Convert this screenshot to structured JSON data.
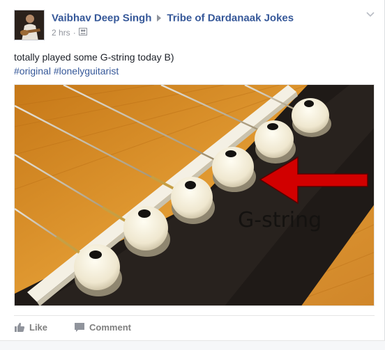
{
  "post": {
    "author": "Vaibhav Deep Singh",
    "group": "Tribe of Dardanaak Jokes",
    "time": "2 hrs",
    "separator": "·",
    "text": "totally played some G-string today B)",
    "hashtags": [
      "#original",
      "#lonelyguitarist"
    ]
  },
  "image": {
    "annotation": "G-string",
    "arrow_color": "#d10000"
  },
  "actions": {
    "like_label": "Like",
    "comment_label": "Comment"
  },
  "colors": {
    "link": "#365899",
    "muted": "#90949c"
  },
  "icons": {
    "audience": "group-audience-icon",
    "menu": "chevron-down-icon",
    "like": "thumbs-up-icon",
    "comment": "comment-icon"
  }
}
